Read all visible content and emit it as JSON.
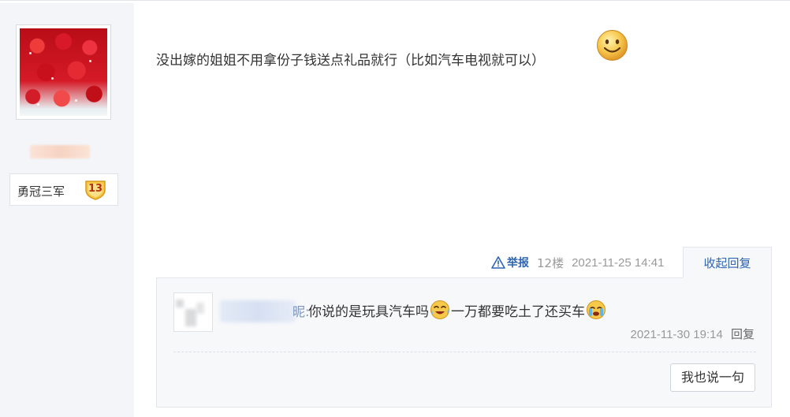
{
  "author": {
    "level_name": "勇冠三军",
    "level_number": "13"
  },
  "post": {
    "content": "没出嫁的姐姐不用拿份子钱送点礼品就行（比如汽车电视就可以）",
    "emoji_icon": "smile-emoji-icon",
    "report_label": "举报",
    "floor": "12楼",
    "timestamp": "2021-11-25 14:41",
    "collapse_label": "收起回复"
  },
  "reply": {
    "name_tail": "昵:",
    "text_part1": "你说的是玩具汽车吗",
    "text_part2": "一万都要吃土了还买车",
    "emoji_1": "tears-of-joy-emoji-icon",
    "emoji_2": "crying-emoji-icon",
    "timestamp": "2021-11-30 19:14",
    "reply_label": "回复"
  },
  "say_button_label": "我也说一句",
  "colors": {
    "link_blue": "#2d64b3",
    "sidebar_bg": "#f3f5f9",
    "panel_bg": "#f7f8fa",
    "meta_gray": "#999999"
  }
}
